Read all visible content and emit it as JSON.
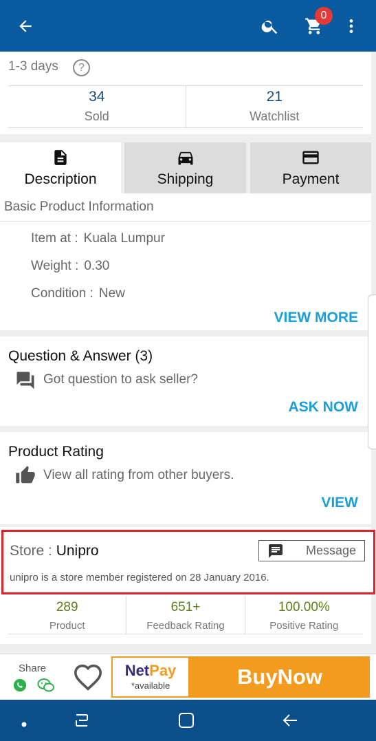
{
  "appbar": {
    "back_icon": "arrow-left-icon",
    "search_icon": "search-icon",
    "cart_icon": "cart-icon",
    "cart_count": "0",
    "menu_icon": "more-vert-icon",
    "color": "#0a5aa0"
  },
  "delivery": {
    "text": "1-3 days",
    "help_icon": "question-circle-icon",
    "help_glyph": "?"
  },
  "top_stats": [
    {
      "value": "34",
      "label": "Sold"
    },
    {
      "value": "21",
      "label": "Watchlist"
    }
  ],
  "tabs": [
    {
      "label": "Description",
      "icon": "document-icon",
      "active": true
    },
    {
      "label": "Shipping",
      "icon": "car-icon",
      "active": false
    },
    {
      "label": "Payment",
      "icon": "credit-card-icon",
      "active": false
    }
  ],
  "description": {
    "section_title": "Basic Product Information",
    "rows": [
      {
        "label": "Item at :",
        "value": "Kuala Lumpur"
      },
      {
        "label": "Weight :",
        "value": "0.30"
      },
      {
        "label": "Condition :",
        "value": "New"
      }
    ],
    "view_more": "VIEW MORE"
  },
  "qa": {
    "title": "Question & Answer (3)",
    "subtitle": "Got question to ask seller?",
    "icon": "forum-icon",
    "action": "ASK NOW"
  },
  "rating": {
    "title": "Product Rating",
    "subtitle": "View all rating from other buyers.",
    "icon": "thumbs-up-icon",
    "action": "VIEW"
  },
  "store": {
    "prefix": "Store : ",
    "name": "Unipro",
    "message_label": "Message",
    "message_icon": "chat-icon",
    "description": "unipro is a store member registered on 28 January 2016.",
    "highlight_color": "#e0202a"
  },
  "store_stats": [
    {
      "value": "289",
      "label": "Product"
    },
    {
      "value": "651+",
      "label": "Feedback Rating"
    },
    {
      "value": "100.00%",
      "label": "Positive Rating"
    }
  ],
  "bottom": {
    "share_label": "Share",
    "whatsapp_icon": "whatsapp-icon",
    "wechat_icon": "wechat-icon",
    "wishlist_icon": "heart-outline-icon",
    "netpay_net": "Net",
    "netpay_pay": "Pay",
    "netpay_available": "*available",
    "buy_label": "BuyNow",
    "accent": "#f29b1e"
  },
  "system_nav": {
    "dot_icon": "dot-icon",
    "recents_icon": "recents-icon",
    "home_icon": "home-icon",
    "back_icon": "back-icon"
  }
}
